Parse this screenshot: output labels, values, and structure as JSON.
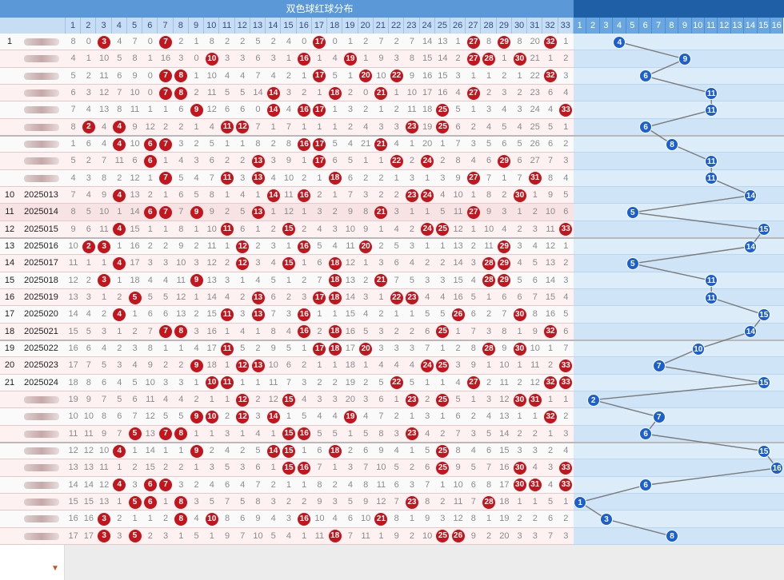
{
  "header": {
    "red_title": "双色球红球分布",
    "red_numbers": [
      1,
      2,
      3,
      4,
      5,
      6,
      7,
      8,
      9,
      10,
      11,
      12,
      13,
      14,
      15,
      16,
      17,
      18,
      19,
      20,
      21,
      22,
      23,
      24,
      25,
      26,
      27,
      28,
      29,
      30,
      31,
      32,
      33
    ],
    "blue_numbers": [
      1,
      2,
      3,
      4,
      5,
      6,
      7,
      8,
      9,
      10,
      11,
      12,
      13,
      14,
      15,
      16
    ]
  },
  "colors": {
    "red_ball": "#c4141c",
    "blue_ball": "#1c5fd0",
    "header_band": "#5a98d8",
    "blue_zone": "#dcecf9"
  },
  "rows": [
    {
      "seq": "1",
      "period": "",
      "reds": [
        3,
        7,
        17,
        27,
        29,
        32
      ],
      "blue": 4,
      "misses": [
        8,
        0,
        9,
        4,
        7,
        0,
        15,
        2,
        1,
        8,
        2,
        2,
        5,
        2,
        4,
        0,
        1,
        0,
        1,
        2,
        7,
        2,
        7,
        14,
        13,
        1,
        0,
        8,
        0,
        8,
        20,
        0,
        1
      ]
    },
    {
      "seq": "",
      "period": "",
      "reds": [
        10,
        16,
        19,
        27,
        28,
        30
      ],
      "blue": 9,
      "misses": [
        4,
        1,
        10,
        5,
        8,
        1,
        16,
        3,
        0,
        9,
        3,
        3,
        6,
        3,
        1,
        0,
        1,
        4,
        0,
        1,
        9,
        3,
        8,
        15,
        14,
        2,
        0,
        0,
        1,
        0,
        21,
        1,
        2
      ]
    },
    {
      "seq": "",
      "period": "",
      "reds": [
        7,
        8,
        17,
        20,
        22,
        32
      ],
      "blue": 6,
      "misses": [
        5,
        2,
        11,
        6,
        9,
        0,
        0,
        4,
        1,
        10,
        4,
        4,
        7,
        4,
        2,
        1,
        0,
        5,
        1,
        0,
        10,
        0,
        9,
        16,
        15,
        3,
        1,
        1,
        2,
        1,
        22,
        5,
        3
      ]
    },
    {
      "seq": "",
      "period": "",
      "reds": [
        7,
        8,
        14,
        18,
        21,
        27
      ],
      "blue": 11,
      "misses": [
        6,
        3,
        12,
        7,
        10,
        0,
        0,
        5,
        2,
        11,
        5,
        5,
        14,
        5,
        3,
        2,
        1,
        0,
        2,
        0,
        0,
        1,
        10,
        17,
        16,
        4,
        0,
        2,
        3,
        2,
        23,
        6,
        4
      ]
    },
    {
      "seq": "",
      "period": "",
      "reds": [
        9,
        14,
        16,
        17,
        25,
        33
      ],
      "blue": 11,
      "misses": [
        7,
        4,
        13,
        8,
        11,
        1,
        1,
        6,
        0,
        12,
        6,
        6,
        0,
        5,
        4,
        0,
        0,
        1,
        3,
        2,
        1,
        2,
        11,
        18,
        0,
        5,
        1,
        3,
        4,
        3,
        24,
        4,
        0
      ]
    },
    {
      "seq": "",
      "period": "",
      "reds": [
        2,
        4,
        11,
        12,
        23,
        25
      ],
      "blue": 6,
      "misses": [
        8,
        0,
        4,
        0,
        9,
        12,
        2,
        2,
        1,
        4,
        0,
        0,
        7,
        1,
        7,
        1,
        1,
        1,
        2,
        4,
        3,
        3,
        0,
        19,
        0,
        6,
        2,
        4,
        5,
        4,
        25,
        5,
        1
      ]
    },
    {
      "seq": "",
      "period": "",
      "reds": [
        4,
        6,
        7,
        16,
        17,
        21
      ],
      "blue": 8,
      "misses": [
        1,
        6,
        4,
        0,
        10,
        0,
        0,
        3,
        2,
        5,
        1,
        1,
        8,
        2,
        8,
        0,
        0,
        5,
        4,
        21,
        0,
        4,
        1,
        20,
        1,
        7,
        3,
        5,
        6,
        5,
        26,
        6,
        2
      ]
    },
    {
      "seq": "",
      "period": "",
      "reds": [
        6,
        13,
        17,
        22,
        24,
        29
      ],
      "blue": 11,
      "misses": [
        5,
        2,
        7,
        11,
        6,
        0,
        1,
        4,
        3,
        6,
        2,
        2,
        0,
        3,
        9,
        1,
        0,
        6,
        5,
        1,
        1,
        0,
        2,
        0,
        2,
        8,
        4,
        6,
        0,
        6,
        27,
        7,
        3
      ]
    },
    {
      "seq": "",
      "period": "",
      "reds": [
        7,
        11,
        13,
        18,
        27,
        31
      ],
      "blue": 11,
      "misses": [
        4,
        3,
        8,
        2,
        12,
        1,
        0,
        5,
        4,
        7,
        0,
        3,
        0,
        4,
        10,
        2,
        1,
        0,
        6,
        2,
        2,
        1,
        3,
        1,
        3,
        9,
        0,
        7,
        1,
        7,
        0,
        8,
        4
      ]
    },
    {
      "seq": "10",
      "period": "2025013",
      "reds": [
        4,
        14,
        16,
        23,
        24,
        30
      ],
      "blue": 14,
      "misses": [
        7,
        4,
        9,
        0,
        13,
        2,
        1,
        6,
        5,
        8,
        1,
        4,
        1,
        0,
        11,
        0,
        2,
        1,
        7,
        3,
        2,
        2,
        0,
        0,
        4,
        10,
        1,
        8,
        2,
        0,
        1,
        9,
        5
      ]
    },
    {
      "seq": "11",
      "period": "2025014",
      "reds": [
        6,
        7,
        9,
        13,
        21,
        27
      ],
      "blue": 5,
      "misses": [
        8,
        5,
        10,
        1,
        14,
        0,
        0,
        7,
        0,
        9,
        2,
        5,
        0,
        1,
        12,
        1,
        3,
        2,
        9,
        8,
        0,
        3,
        1,
        1,
        5,
        11,
        0,
        9,
        3,
        1,
        2,
        10,
        6
      ]
    },
    {
      "seq": "12",
      "period": "2025015",
      "reds": [
        4,
        11,
        15,
        24,
        25,
        33
      ],
      "blue": 15,
      "misses": [
        9,
        6,
        11,
        0,
        15,
        1,
        1,
        8,
        1,
        10,
        0,
        6,
        1,
        2,
        0,
        2,
        4,
        3,
        10,
        9,
        1,
        4,
        2,
        0,
        0,
        12,
        1,
        10,
        4,
        2,
        3,
        11,
        0
      ]
    },
    {
      "seq": "13",
      "period": "2025016",
      "reds": [
        2,
        3,
        12,
        16,
        20,
        29
      ],
      "blue": 14,
      "misses": [
        10,
        0,
        0,
        1,
        16,
        2,
        2,
        9,
        2,
        11,
        1,
        0,
        2,
        3,
        1,
        0,
        5,
        4,
        11,
        0,
        2,
        5,
        3,
        1,
        1,
        13,
        2,
        11,
        0,
        3,
        4,
        12,
        1
      ]
    },
    {
      "seq": "14",
      "period": "2025017",
      "reds": [
        4,
        12,
        15,
        18,
        28,
        29
      ],
      "blue": 5,
      "misses": [
        11,
        1,
        1,
        0,
        17,
        3,
        3,
        10,
        3,
        12,
        2,
        0,
        3,
        4,
        0,
        1,
        6,
        0,
        12,
        1,
        3,
        6,
        4,
        2,
        2,
        14,
        3,
        0,
        0,
        4,
        5,
        13,
        2
      ]
    },
    {
      "seq": "15",
      "period": "2025018",
      "reds": [
        3,
        9,
        18,
        21,
        28,
        29
      ],
      "blue": 11,
      "misses": [
        12,
        2,
        0,
        1,
        18,
        4,
        4,
        11,
        0,
        13,
        3,
        1,
        4,
        5,
        1,
        2,
        7,
        0,
        13,
        2,
        0,
        7,
        5,
        3,
        3,
        15,
        4,
        0,
        0,
        5,
        6,
        14,
        3
      ]
    },
    {
      "seq": "16",
      "period": "2025019",
      "reds": [
        5,
        13,
        17,
        18,
        22,
        23
      ],
      "blue": 11,
      "misses": [
        13,
        3,
        1,
        2,
        0,
        5,
        5,
        12,
        1,
        14,
        4,
        2,
        0,
        6,
        2,
        3,
        0,
        0,
        14,
        3,
        1,
        0,
        0,
        4,
        4,
        16,
        5,
        1,
        6,
        6,
        7,
        15,
        4
      ]
    },
    {
      "seq": "17",
      "period": "2025020",
      "reds": [
        4,
        11,
        13,
        16,
        26,
        30
      ],
      "blue": 15,
      "misses": [
        14,
        4,
        2,
        0,
        1,
        6,
        6,
        13,
        2,
        15,
        0,
        3,
        0,
        7,
        3,
        0,
        1,
        1,
        15,
        4,
        2,
        1,
        1,
        5,
        5,
        0,
        6,
        2,
        7,
        0,
        8,
        16,
        5
      ]
    },
    {
      "seq": "18",
      "period": "2025021",
      "reds": [
        7,
        8,
        16,
        18,
        25,
        32
      ],
      "blue": 14,
      "misses": [
        15,
        5,
        3,
        1,
        2,
        7,
        0,
        0,
        3,
        16,
        1,
        4,
        1,
        8,
        4,
        0,
        2,
        0,
        16,
        5,
        3,
        2,
        2,
        6,
        0,
        1,
        7,
        3,
        8,
        1,
        9,
        0,
        6
      ]
    },
    {
      "seq": "19",
      "period": "2025022",
      "reds": [
        11,
        17,
        18,
        20,
        28,
        30
      ],
      "blue": 10,
      "misses": [
        16,
        6,
        4,
        2,
        3,
        8,
        1,
        1,
        4,
        17,
        0,
        5,
        2,
        9,
        5,
        1,
        0,
        0,
        17,
        0,
        3,
        3,
        3,
        7,
        1,
        2,
        8,
        0,
        9,
        0,
        10,
        1,
        7
      ]
    },
    {
      "seq": "20",
      "period": "2025023",
      "reds": [
        9,
        12,
        13,
        24,
        25,
        33
      ],
      "blue": 7,
      "misses": [
        17,
        7,
        5,
        3,
        4,
        9,
        2,
        2,
        0,
        18,
        1,
        0,
        0,
        10,
        6,
        2,
        1,
        1,
        18,
        1,
        4,
        4,
        4,
        0,
        0,
        3,
        9,
        1,
        10,
        1,
        11,
        2,
        0
      ]
    },
    {
      "seq": "21",
      "period": "2025024",
      "reds": [
        10,
        11,
        22,
        27,
        32,
        33
      ],
      "blue": 15,
      "misses": [
        18,
        8,
        6,
        4,
        5,
        10,
        3,
        3,
        1,
        0,
        0,
        1,
        1,
        11,
        7,
        3,
        2,
        2,
        19,
        2,
        5,
        0,
        5,
        1,
        1,
        4,
        0,
        2,
        11,
        2,
        12,
        0,
        0
      ]
    },
    {
      "seq": "",
      "period": "",
      "reds": [
        12,
        15,
        23,
        25,
        30,
        31
      ],
      "blue": 2,
      "misses": [
        19,
        9,
        7,
        5,
        6,
        11,
        4,
        4,
        2,
        1,
        1,
        0,
        2,
        12,
        0,
        4,
        3,
        3,
        20,
        3,
        6,
        1,
        0,
        2,
        0,
        5,
        1,
        3,
        12,
        0,
        0,
        1,
        1
      ]
    },
    {
      "seq": "",
      "period": "",
      "reds": [
        9,
        10,
        12,
        14,
        19,
        32
      ],
      "blue": 7,
      "misses": [
        10,
        10,
        8,
        6,
        7,
        12,
        5,
        5,
        0,
        0,
        2,
        0,
        3,
        0,
        1,
        5,
        4,
        4,
        0,
        4,
        7,
        2,
        1,
        3,
        1,
        6,
        2,
        4,
        13,
        1,
        1,
        0,
        2
      ]
    },
    {
      "seq": "",
      "period": "",
      "reds": [
        5,
        7,
        8,
        15,
        16,
        23
      ],
      "blue": 6,
      "misses": [
        11,
        11,
        9,
        7,
        0,
        13,
        0,
        0,
        1,
        1,
        3,
        1,
        4,
        1,
        0,
        0,
        5,
        5,
        1,
        5,
        8,
        3,
        0,
        4,
        2,
        7,
        3,
        5,
        14,
        2,
        2,
        1,
        3
      ]
    },
    {
      "seq": "",
      "period": "",
      "reds": [
        4,
        9,
        14,
        15,
        18,
        25
      ],
      "blue": 15,
      "misses": [
        12,
        12,
        10,
        0,
        1,
        14,
        1,
        1,
        0,
        2,
        4,
        2,
        5,
        0,
        0,
        1,
        6,
        0,
        2,
        6,
        9,
        4,
        1,
        5,
        0,
        8,
        4,
        6,
        15,
        3,
        3,
        2,
        4
      ]
    },
    {
      "seq": "",
      "period": "",
      "reds": [
        15,
        16,
        25,
        30,
        33
      ],
      "blue": 16,
      "misses": [
        13,
        13,
        11,
        1,
        2,
        15,
        2,
        2,
        1,
        3,
        5,
        3,
        6,
        1,
        0,
        0,
        7,
        1,
        3,
        7,
        10,
        5,
        2,
        6,
        0,
        9,
        5,
        7,
        16,
        0,
        4,
        3,
        0
      ]
    },
    {
      "seq": "",
      "period": "",
      "reds": [
        4,
        6,
        7,
        30,
        31,
        33
      ],
      "blue": 6,
      "misses": [
        14,
        14,
        12,
        0,
        3,
        0,
        0,
        3,
        2,
        4,
        6,
        4,
        7,
        2,
        1,
        1,
        8,
        2,
        4,
        8,
        11,
        6,
        3,
        7,
        1,
        10,
        6,
        8,
        17,
        0,
        0,
        4,
        0
      ]
    },
    {
      "seq": "",
      "period": "",
      "reds": [
        5,
        6,
        8,
        23,
        28
      ],
      "blue": 1,
      "misses": [
        15,
        15,
        13,
        1,
        0,
        0,
        1,
        0,
        3,
        5,
        7,
        5,
        8,
        3,
        2,
        2,
        9,
        3,
        5,
        9,
        12,
        7,
        0,
        8,
        2,
        11,
        7,
        0,
        18,
        1,
        1,
        5,
        1
      ]
    },
    {
      "seq": "",
      "period": "",
      "reds": [
        3,
        8,
        10,
        16,
        21
      ],
      "blue": 3,
      "misses": [
        16,
        16,
        0,
        2,
        1,
        1,
        2,
        0,
        4,
        0,
        8,
        6,
        9,
        4,
        3,
        0,
        10,
        4,
        6,
        10,
        0,
        8,
        1,
        9,
        3,
        12,
        8,
        1,
        19,
        2,
        2,
        6,
        2
      ]
    },
    {
      "seq": "",
      "period": "",
      "reds": [
        3,
        5,
        18,
        25,
        26
      ],
      "blue": 8,
      "misses": [
        17,
        17,
        0,
        3,
        0,
        2,
        3,
        1,
        5,
        1,
        9,
        7,
        10,
        5,
        4,
        1,
        11,
        0,
        7,
        11,
        1,
        9,
        2,
        10,
        0,
        0,
        9,
        2,
        20,
        3,
        3,
        7,
        3
      ]
    }
  ]
}
